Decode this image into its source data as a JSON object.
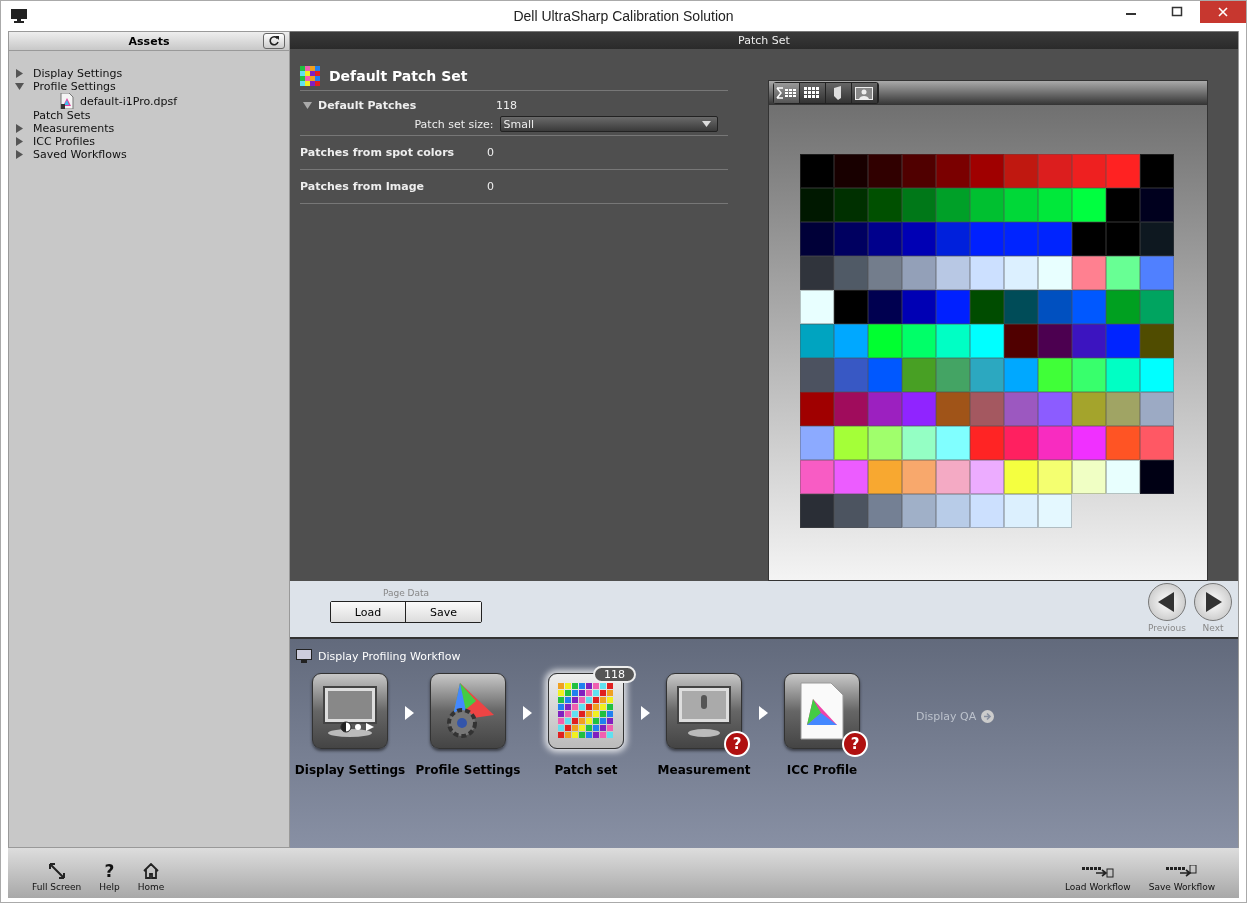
{
  "window": {
    "title": "Dell UltraSharp Calibration Solution"
  },
  "sidebar": {
    "title": "Assets",
    "items": [
      {
        "label": "Display Settings",
        "kind": "group",
        "expanded": false
      },
      {
        "label": "Profile Settings",
        "kind": "group",
        "expanded": true,
        "children": [
          {
            "label": "default-i1Pro.dpsf",
            "kind": "file"
          }
        ]
      },
      {
        "label": "Patch Sets",
        "kind": "item"
      },
      {
        "label": "Measurements",
        "kind": "group",
        "expanded": false
      },
      {
        "label": "ICC Profiles",
        "kind": "group",
        "expanded": false
      },
      {
        "label": "Saved Workflows",
        "kind": "group",
        "expanded": false
      }
    ]
  },
  "panel_title": "Patch Set",
  "patch_set": {
    "title": "Default Patch Set",
    "default_patches": {
      "label": "Default Patches",
      "expanded": true,
      "count": "118",
      "size_label": "Patch set size:",
      "size_value": "Small"
    },
    "rows": [
      {
        "label": "Patches from spot colors",
        "value": "0"
      },
      {
        "label": "Patches from Image",
        "value": "0"
      }
    ]
  },
  "view_tools": [
    {
      "kind": "list",
      "selected": true
    },
    {
      "kind": "grid",
      "selected": false
    },
    {
      "kind": "spot",
      "selected": false
    },
    {
      "kind": "image",
      "selected": false
    }
  ],
  "patches": [
    {
      "color": "#000000"
    },
    {
      "color": "#180000"
    },
    {
      "color": "#300000"
    },
    {
      "color": "#500000"
    },
    {
      "color": "#7a0000"
    },
    {
      "color": "#a00000"
    },
    {
      "color": "#c01810"
    },
    {
      "color": "#dc1e1e"
    },
    {
      "color": "#ee2020"
    },
    {
      "color": "#ff2222"
    },
    {
      "color": "#000000"
    },
    {
      "color": "#001800"
    },
    {
      "color": "#003000"
    },
    {
      "color": "#005000"
    },
    {
      "color": "#007818"
    },
    {
      "color": "#00a028"
    },
    {
      "color": "#00c030"
    },
    {
      "color": "#00d838"
    },
    {
      "color": "#00e83a"
    },
    {
      "color": "#00ff40"
    },
    {
      "color": "#000000"
    },
    {
      "color": "#00001e"
    },
    {
      "color": "#000038"
    },
    {
      "color": "#000060"
    },
    {
      "color": "#00008c"
    },
    {
      "color": "#0000b4"
    },
    {
      "color": "#0020dc"
    },
    {
      "color": "#0020ff"
    },
    {
      "color": "#0024ff"
    },
    {
      "color": "#0024fe"
    },
    {
      "color": "#000000"
    },
    {
      "color": "#000000"
    },
    {
      "color": "#0e1820"
    },
    {
      "color": "#30343c"
    },
    {
      "color": "#505a66"
    },
    {
      "color": "#737d8c"
    },
    {
      "color": "#93a0b8"
    },
    {
      "color": "#b8c8e4"
    },
    {
      "color": "#cce0ff"
    },
    {
      "color": "#dcf0ff"
    },
    {
      "color": "#e8ffff"
    },
    {
      "color": "#ff8090"
    },
    {
      "color": "#68ff94"
    },
    {
      "color": "#5080ff"
    },
    {
      "color": "#e8ffff"
    },
    {
      "color": "#000000"
    },
    {
      "color": "#000050"
    },
    {
      "color": "#0000b4"
    },
    {
      "color": "#0020ff"
    },
    {
      "color": "#004c00"
    },
    {
      "color": "#004c58"
    },
    {
      "color": "#0050c0"
    },
    {
      "color": "#0058ff"
    },
    {
      "color": "#00a020"
    },
    {
      "color": "#00a460"
    },
    {
      "color": "#00a4c0"
    },
    {
      "color": "#00a8ff"
    },
    {
      "color": "#00ff30"
    },
    {
      "color": "#00ff68"
    },
    {
      "color": "#00ffc4"
    },
    {
      "color": "#00ffff"
    },
    {
      "color": "#500000"
    },
    {
      "color": "#4c0050"
    },
    {
      "color": "#3c14c0"
    },
    {
      "color": "#0024ff"
    },
    {
      "color": "#504c00"
    },
    {
      "color": "#4c5260"
    },
    {
      "color": "#3858c4"
    },
    {
      "color": "#0058ff"
    },
    {
      "color": "#48a024"
    },
    {
      "color": "#44a464"
    },
    {
      "color": "#2ca8c0"
    },
    {
      "color": "#00a8ff"
    },
    {
      "color": "#40ff38"
    },
    {
      "color": "#38ff6c"
    },
    {
      "color": "#00ffc4"
    },
    {
      "color": "#00ffff"
    },
    {
      "color": "#a00000"
    },
    {
      "color": "#a00c5c"
    },
    {
      "color": "#9c20c0"
    },
    {
      "color": "#9024ff"
    },
    {
      "color": "#a05418"
    },
    {
      "color": "#a45860"
    },
    {
      "color": "#9c58c0"
    },
    {
      "color": "#8c5cff"
    },
    {
      "color": "#a4a42c"
    },
    {
      "color": "#a0a464"
    },
    {
      "color": "#9caac4"
    },
    {
      "color": "#8caaff"
    },
    {
      "color": "#a4ff38"
    },
    {
      "color": "#a0ff6c"
    },
    {
      "color": "#94ffc4"
    },
    {
      "color": "#80ffff"
    },
    {
      "color": "#ff2424"
    },
    {
      "color": "#ff2060"
    },
    {
      "color": "#f82cc0"
    },
    {
      "color": "#f030ff"
    },
    {
      "color": "#ff5424"
    },
    {
      "color": "#ff5864"
    },
    {
      "color": "#f85cc4"
    },
    {
      "color": "#ec5cff"
    },
    {
      "color": "#f8a830"
    },
    {
      "color": "#f8a86c"
    },
    {
      "color": "#f4aac4"
    },
    {
      "color": "#ecacff"
    },
    {
      "color": "#f4ff40"
    },
    {
      "color": "#f4ff70"
    },
    {
      "color": "#f0ffc4"
    },
    {
      "color": "#e8fffe"
    },
    {
      "color": "#000014"
    },
    {
      "color": "#2a2e36"
    },
    {
      "color": "#4c5460"
    },
    {
      "color": "#748094"
    },
    {
      "color": "#a0b0c8"
    },
    {
      "color": "#b8cce8"
    },
    {
      "color": "#cce0fe"
    },
    {
      "color": "#dcf0fe"
    },
    {
      "color": "#e4f8ff"
    }
  ],
  "page_data": {
    "label": "Page Data",
    "buttons": [
      "Load",
      "Save"
    ]
  },
  "nav": [
    {
      "kind": "previous",
      "label": "Previous"
    },
    {
      "kind": "next",
      "label": "Next"
    }
  ],
  "workflow": {
    "title": "Display Profiling Workflow",
    "steps": [
      {
        "kind": "display",
        "label": "Display Settings",
        "selected": false
      },
      {
        "kind": "profile",
        "label": "Profile Settings",
        "selected": false
      },
      {
        "kind": "patch",
        "label": "Patch set",
        "selected": true,
        "badge": "118"
      },
      {
        "kind": "measure",
        "label": "Measurement",
        "selected": false,
        "warning": "?"
      },
      {
        "kind": "icc",
        "label": "ICC Profile",
        "selected": false,
        "warning": "?"
      }
    ],
    "extra": "Display QA"
  },
  "toolbar_left": [
    {
      "kind": "fullscreen",
      "label": "Full Screen"
    },
    {
      "kind": "help",
      "label": "Help",
      "glyph": "?"
    },
    {
      "kind": "home",
      "label": "Home"
    }
  ],
  "toolbar_right": [
    {
      "kind": "load",
      "label": "Load Workflow"
    },
    {
      "kind": "save",
      "label": "Save Workflow"
    }
  ]
}
